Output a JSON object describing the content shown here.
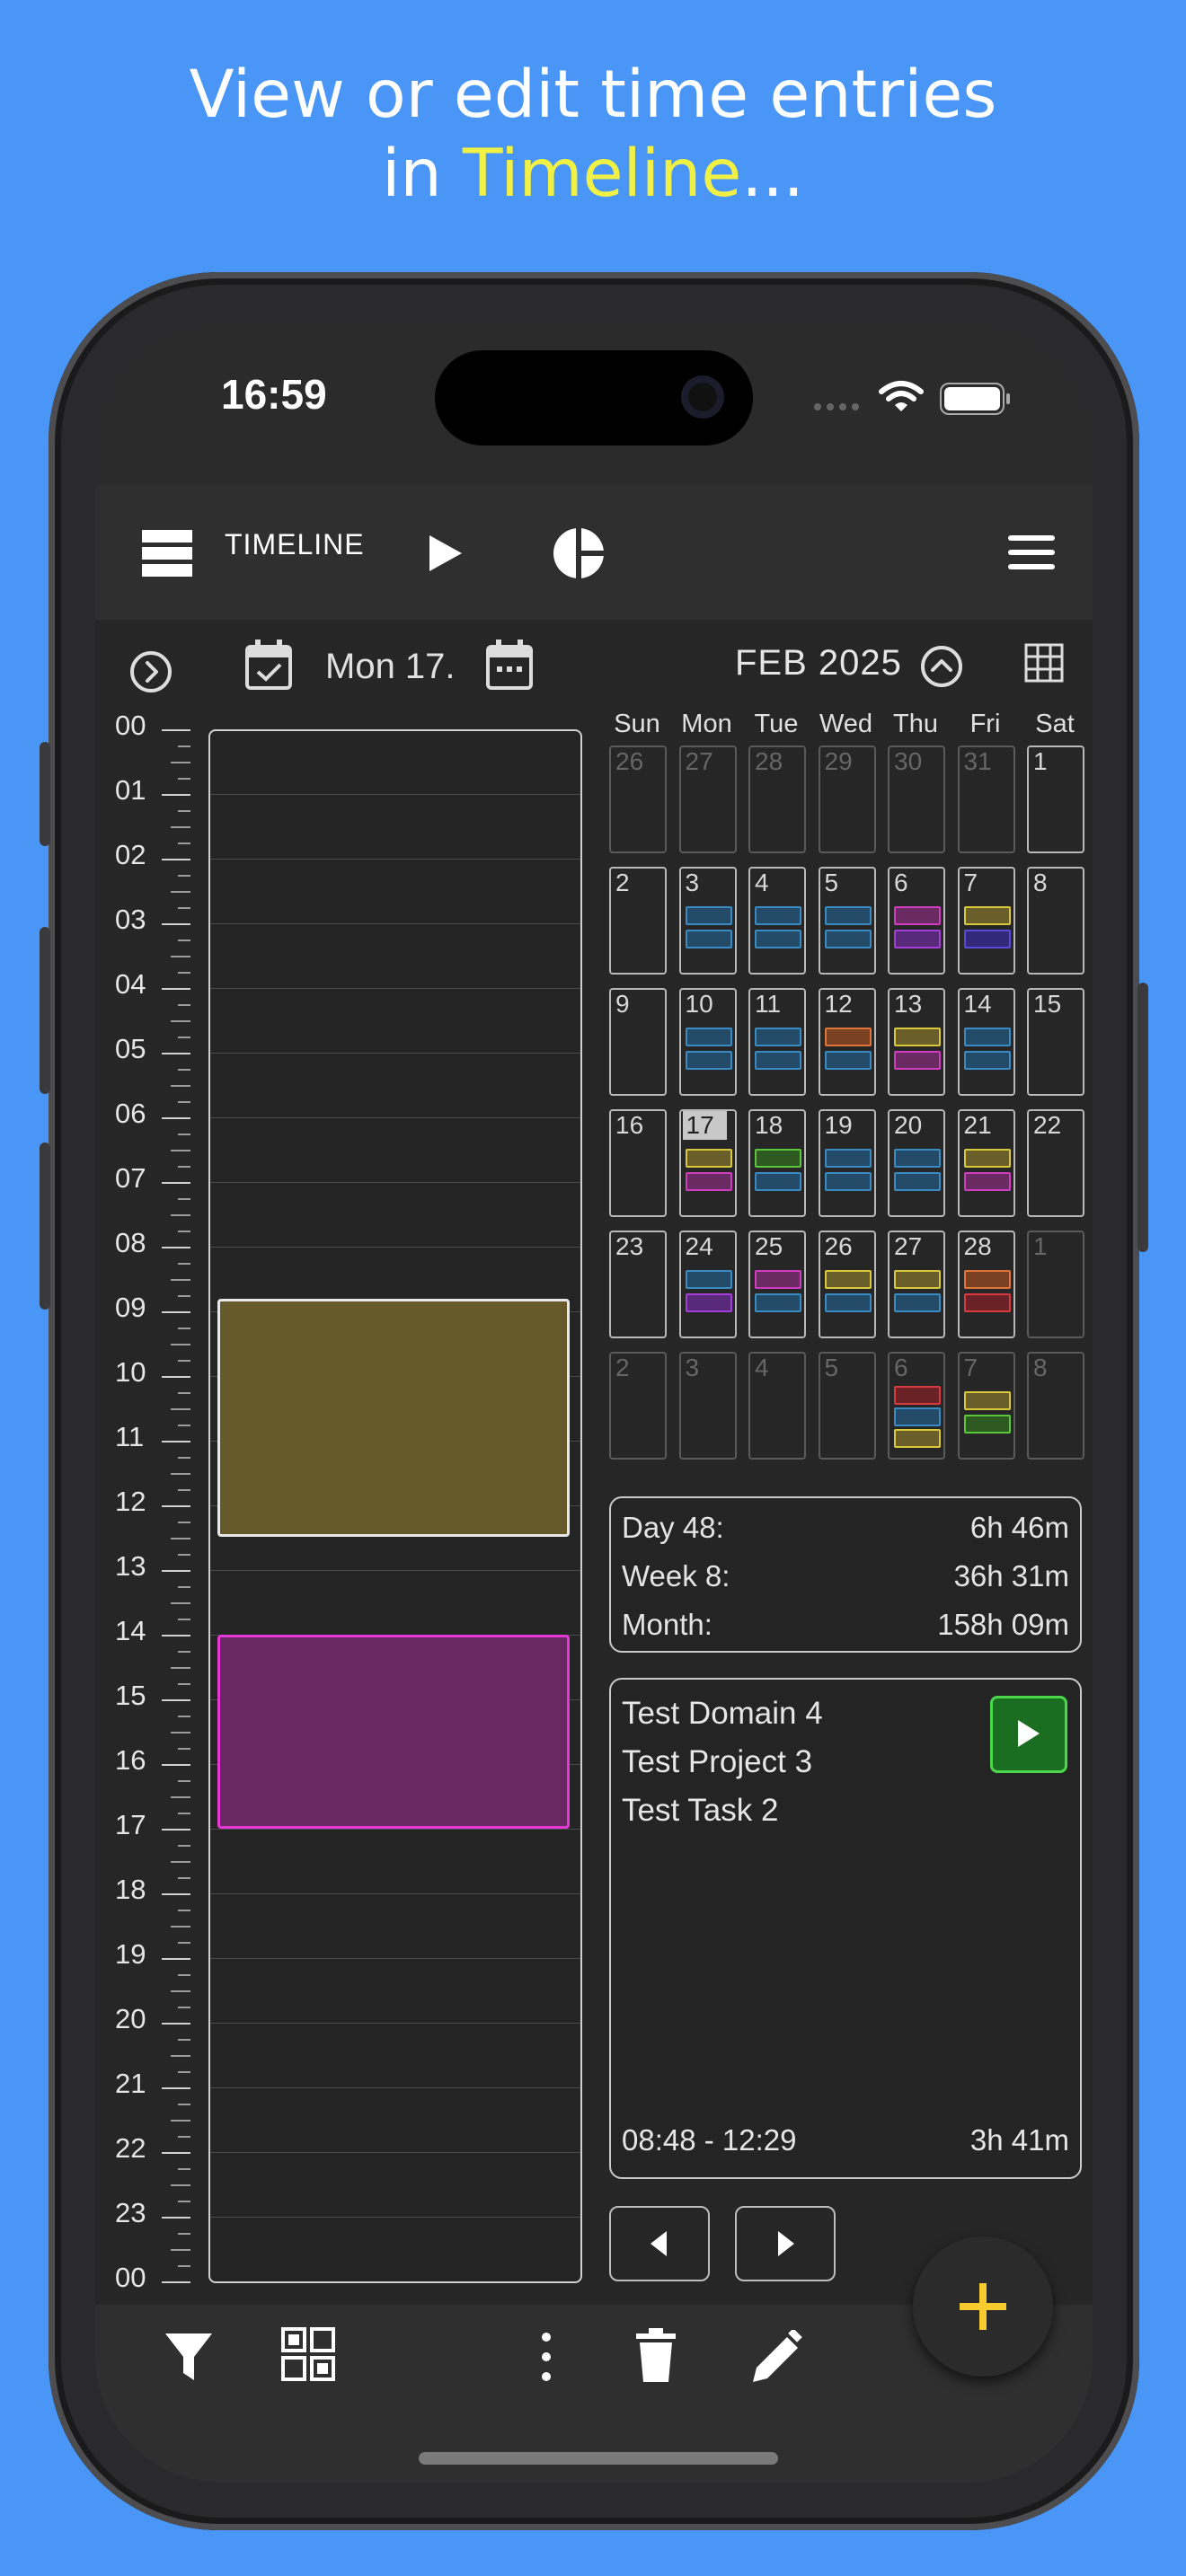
{
  "caption": {
    "line1": "View or edit time entries",
    "line2_prefix": "in ",
    "line2_highlight": "Timeline",
    "line2_suffix": "..."
  },
  "status": {
    "time": "16:59"
  },
  "appbar": {
    "title": "TIMELINE"
  },
  "datebar": {
    "date": "Mon 17.",
    "month": "FEB 2025"
  },
  "hours": [
    "00",
    "01",
    "02",
    "03",
    "04",
    "05",
    "06",
    "07",
    "08",
    "09",
    "10",
    "11",
    "12",
    "13",
    "14",
    "15",
    "16",
    "17",
    "18",
    "19",
    "20",
    "21",
    "22",
    "23",
    "00"
  ],
  "timeline_entries": [
    {
      "start": "08:48",
      "end": "12:29",
      "color": "#675a2a",
      "border": "#e8e8e8"
    },
    {
      "start": "14:00",
      "end": "17:00",
      "color": "#6a2862",
      "border": "#e33ad6"
    }
  ],
  "calendar": {
    "weekdays": [
      "Sun",
      "Mon",
      "Tue",
      "Wed",
      "Thu",
      "Fri",
      "Sat"
    ],
    "today": "17",
    "weeks": [
      [
        {
          "d": "26",
          "dim": true,
          "bars": []
        },
        {
          "d": "27",
          "dim": true,
          "bars": []
        },
        {
          "d": "28",
          "dim": true,
          "bars": []
        },
        {
          "d": "29",
          "dim": true,
          "bars": []
        },
        {
          "d": "30",
          "dim": true,
          "bars": []
        },
        {
          "d": "31",
          "dim": true,
          "bars": []
        },
        {
          "d": "1",
          "cur": true,
          "bars": []
        }
      ],
      [
        {
          "d": "2",
          "cur": true,
          "bars": []
        },
        {
          "d": "3",
          "cur": true,
          "bars": [
            "blue",
            "blue"
          ]
        },
        {
          "d": "4",
          "cur": true,
          "bars": [
            "blue",
            "blue"
          ]
        },
        {
          "d": "5",
          "cur": true,
          "bars": [
            "blue",
            "blue"
          ]
        },
        {
          "d": "6",
          "cur": true,
          "bars": [
            "magenta",
            "purple"
          ]
        },
        {
          "d": "7",
          "cur": true,
          "bars": [
            "yellow",
            "indigo"
          ]
        },
        {
          "d": "8",
          "cur": true,
          "bars": []
        }
      ],
      [
        {
          "d": "9",
          "cur": true,
          "bars": []
        },
        {
          "d": "10",
          "cur": true,
          "bars": [
            "blue",
            "blue"
          ]
        },
        {
          "d": "11",
          "cur": true,
          "bars": [
            "blue",
            "blue"
          ]
        },
        {
          "d": "12",
          "cur": true,
          "bars": [
            "orange",
            "blue"
          ]
        },
        {
          "d": "13",
          "cur": true,
          "bars": [
            "yellow",
            "magenta"
          ]
        },
        {
          "d": "14",
          "cur": true,
          "bars": [
            "blue",
            "blue"
          ]
        },
        {
          "d": "15",
          "cur": true,
          "bars": []
        }
      ],
      [
        {
          "d": "16",
          "cur": true,
          "bars": []
        },
        {
          "d": "17",
          "cur": true,
          "today": true,
          "bars": [
            "yellow",
            "magenta"
          ]
        },
        {
          "d": "18",
          "cur": true,
          "bars": [
            "green",
            "blue"
          ]
        },
        {
          "d": "19",
          "cur": true,
          "bars": [
            "blue",
            "blue"
          ]
        },
        {
          "d": "20",
          "cur": true,
          "bars": [
            "blue",
            "blue"
          ]
        },
        {
          "d": "21",
          "cur": true,
          "bars": [
            "yellow",
            "magenta"
          ]
        },
        {
          "d": "22",
          "cur": true,
          "bars": []
        }
      ],
      [
        {
          "d": "23",
          "cur": true,
          "bars": []
        },
        {
          "d": "24",
          "cur": true,
          "bars": [
            "blue",
            "purple"
          ]
        },
        {
          "d": "25",
          "cur": true,
          "bars": [
            "magenta",
            "blue"
          ]
        },
        {
          "d": "26",
          "cur": true,
          "bars": [
            "yellow",
            "blue"
          ]
        },
        {
          "d": "27",
          "cur": true,
          "bars": [
            "yellow",
            "blue"
          ]
        },
        {
          "d": "28",
          "cur": true,
          "bars": [
            "orange",
            "red"
          ]
        },
        {
          "d": "1",
          "dim": true,
          "bars": []
        }
      ],
      [
        {
          "d": "2",
          "dim": true,
          "bars": []
        },
        {
          "d": "3",
          "dim": true,
          "bars": []
        },
        {
          "d": "4",
          "dim": true,
          "bars": []
        },
        {
          "d": "5",
          "dim": true,
          "bars": []
        },
        {
          "d": "6",
          "dim": true,
          "bars": [
            "red",
            "blue",
            "yellow"
          ]
        },
        {
          "d": "7",
          "dim": true,
          "bars": [
            "yellow",
            "green"
          ]
        },
        {
          "d": "8",
          "dim": true,
          "bars": []
        }
      ]
    ]
  },
  "bar_colors": {
    "blue": [
      "#234a66",
      "#3a8bc4"
    ],
    "magenta": [
      "#6a2a62",
      "#d03cc0"
    ],
    "purple": [
      "#5a2a7a",
      "#a33ed8"
    ],
    "yellow": [
      "#6a5e2a",
      "#d8c83a"
    ],
    "indigo": [
      "#33287a",
      "#5a4ad8"
    ],
    "orange": [
      "#7a4222",
      "#e0753a"
    ],
    "green": [
      "#2e5a22",
      "#5ac83a"
    ],
    "red": [
      "#6a2226",
      "#d83a40"
    ]
  },
  "stats": {
    "day_label": "Day 48:",
    "day_value": "6h 46m",
    "week_label": "Week 8:",
    "week_value": "36h 31m",
    "month_label": "Month:",
    "month_value": "158h 09m"
  },
  "entry": {
    "domain": "Test Domain 4",
    "project": "Test Project 3",
    "task": "Test Task 2",
    "time_range": "08:48 - 12:29",
    "duration": "3h 41m"
  }
}
